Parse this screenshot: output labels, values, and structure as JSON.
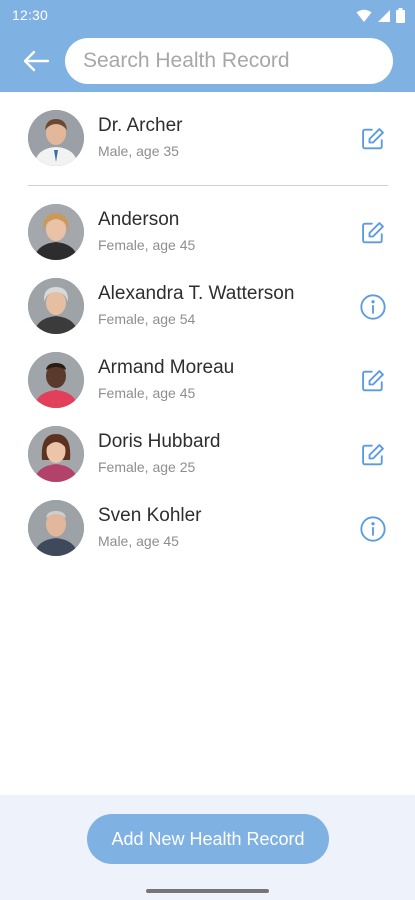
{
  "status_bar": {
    "time": "12:30"
  },
  "search": {
    "placeholder": "Search Health Record"
  },
  "owner": {
    "name": "Dr. Archer",
    "details": "Male, age 35",
    "action_icon": "edit-icon"
  },
  "records": [
    {
      "name": "Anderson",
      "details": "Female, age 45",
      "action": "edit"
    },
    {
      "name": "Alexandra T. Watterson",
      "details": "Female, age 54",
      "action": "info"
    },
    {
      "name": "Armand Moreau",
      "details": "Female, age 45",
      "action": "edit"
    },
    {
      "name": "Doris Hubbard",
      "details": "Female, age 25",
      "action": "edit"
    },
    {
      "name": "Sven Kohler",
      "details": "Male, age 45",
      "action": "info"
    }
  ],
  "add_button": {
    "label": "Add New Health Record"
  },
  "colors": {
    "primary": "#7fb1e3",
    "icon": "#5b9be0",
    "panel": "#eef3fb"
  }
}
